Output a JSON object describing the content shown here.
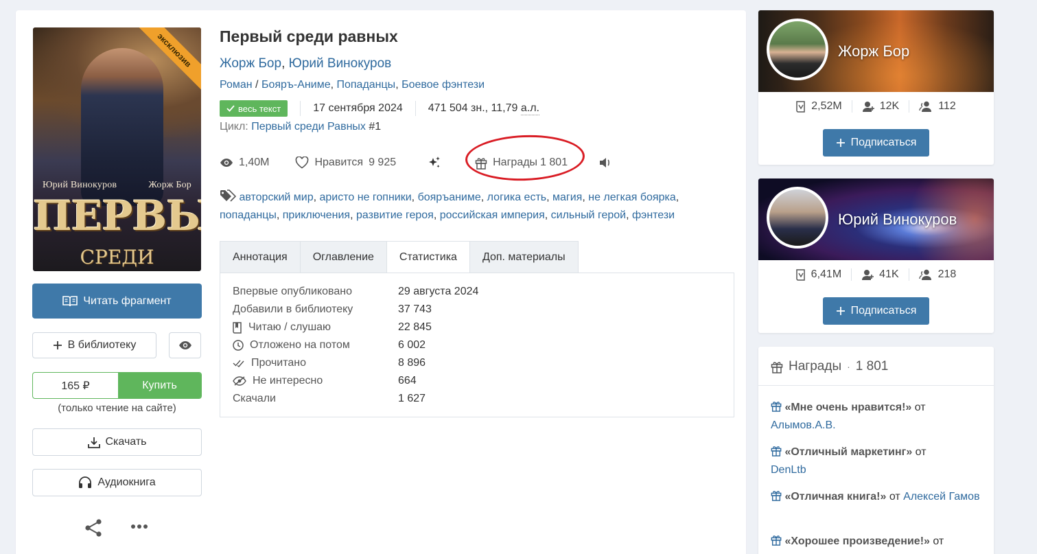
{
  "book": {
    "title": "Первый среди равных",
    "authors": [
      "Жорж Бор",
      "Юрий Винокуров"
    ],
    "genres": [
      "Роман",
      "Бояръ-Аниме",
      "Попаданцы",
      "Боевое фэнтези"
    ],
    "badge": "весь текст",
    "date": "17 сентября 2024",
    "size": "471 504 зн., 11,79",
    "size_unit": "а.л.",
    "cycle_label": "Цикл:",
    "cycle_name": "Первый среди Равных",
    "cycle_num": "#1",
    "cover": {
      "ribbon": "эксклюзив",
      "author_left": "Юрий Винокуров",
      "author_right": "Жорж Бор",
      "title_big": "ПЕРВЫЙ",
      "title_small": "СРЕДИ РАВНЫХ"
    }
  },
  "stats": {
    "views": "1,40M",
    "likes_label": "Нравится",
    "likes": "9 925",
    "awards_label": "Награды",
    "awards": "1 801"
  },
  "tags": [
    "авторский мир",
    "аристо не гопники",
    "бояръаниме",
    "логика есть",
    "магия",
    "не легкая боярка",
    "попаданцы",
    "приключения",
    "развитие героя",
    "российская империя",
    "сильный герой",
    "фэнтези"
  ],
  "tabs": [
    "Аннотация",
    "Оглавление",
    "Статистика",
    "Доп. материалы"
  ],
  "statistics": [
    {
      "label": "Впервые опубликовано",
      "value": "29 августа 2024",
      "icon": ""
    },
    {
      "label": "Добавили в библиотеку",
      "value": "37 743",
      "icon": ""
    },
    {
      "label": "Читаю / слушаю",
      "value": "22 845",
      "icon": "book-icon"
    },
    {
      "label": "Отложено на потом",
      "value": "6 002",
      "icon": "clock-icon"
    },
    {
      "label": "Прочитано",
      "value": "8 896",
      "icon": "double-check-icon"
    },
    {
      "label": "Не интересно",
      "value": "664",
      "icon": "eye-slash-icon"
    },
    {
      "label": "Скачали",
      "value": "1 627",
      "icon": ""
    }
  ],
  "actions": {
    "read_fragment": "Читать фрагмент",
    "add_library": "В библиотеку",
    "price": "165 ₽",
    "buy": "Купить",
    "price_note": "(только чтение на сайте)",
    "download": "Скачать",
    "audiobook": "Аудиокнига"
  },
  "author_cards": [
    {
      "name": "Жорж Бор",
      "books": "2,52M",
      "followers": "12K",
      "friends": "112",
      "subscribe": "Подписаться"
    },
    {
      "name": "Юрий Винокуров",
      "books": "6,41M",
      "followers": "41K",
      "friends": "218",
      "subscribe": "Подписаться"
    }
  ],
  "awards_panel": {
    "title": "Награды",
    "dot": "·",
    "count": "1 801",
    "items": [
      {
        "name": "«Мне очень нравится!»",
        "from": "от",
        "user": "Алымов.А.В."
      },
      {
        "name": "«Отличный маркетинг»",
        "from": "от",
        "user": "DenLtb"
      },
      {
        "name": "«Отличная книга!»",
        "from": "от",
        "user": "Алексей Гамов"
      },
      {
        "name": "«Хорошее произведение!»",
        "from": "от",
        "user": ""
      }
    ]
  },
  "colors": {
    "accent": "#3f79a9",
    "link": "#2f6a9e",
    "green": "#5fb65c",
    "annotation": "#d91c24",
    "ribbon": "#f0a02b"
  }
}
